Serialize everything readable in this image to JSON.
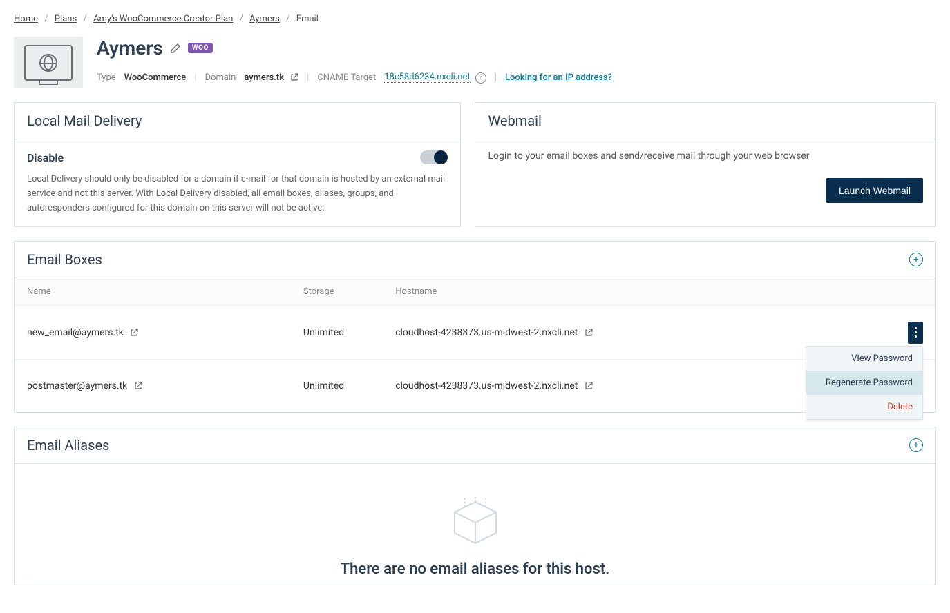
{
  "breadcrumb": {
    "home": "Home",
    "plans": "Plans",
    "plan": "Amy's WooCommerce Creator Plan",
    "site": "Aymers",
    "current": "Email"
  },
  "header": {
    "title": "Aymers",
    "woo_badge": "WOO",
    "type_label": "Type",
    "type_value": "WooCommerce",
    "domain_label": "Domain",
    "domain_value": "aymers.tk",
    "cname_label": "CNAME Target",
    "cname_value": "18c58d6234.nxcli.net",
    "ip_link": "Looking for an IP address?"
  },
  "local_mail": {
    "title": "Local Mail Delivery",
    "toggle_label": "Disable",
    "help": "Local Delivery should only be disabled for a domain if e-mail for that domain is hosted by an external mail service and not this server. With Local Delivery disabled, all email boxes, aliases, groups, and autoresponders configured for this domain on this server will not be active."
  },
  "webmail": {
    "title": "Webmail",
    "desc": "Login to your email boxes and send/receive mail through your web browser",
    "button": "Launch Webmail"
  },
  "email_boxes": {
    "title": "Email Boxes",
    "columns": {
      "name": "Name",
      "storage": "Storage",
      "hostname": "Hostname"
    },
    "rows": [
      {
        "name": "new_email@aymers.tk",
        "storage": "Unlimited",
        "hostname": "cloudhost-4238373.us-midwest-2.nxcli.net"
      },
      {
        "name": "postmaster@aymers.tk",
        "storage": "Unlimited",
        "hostname": "cloudhost-4238373.us-midwest-2.nxcli.net"
      }
    ],
    "menu": {
      "view": "View Password",
      "regen": "Regenerate Password",
      "delete": "Delete"
    }
  },
  "email_aliases": {
    "title": "Email Aliases",
    "empty": "There are no email aliases for this host."
  }
}
